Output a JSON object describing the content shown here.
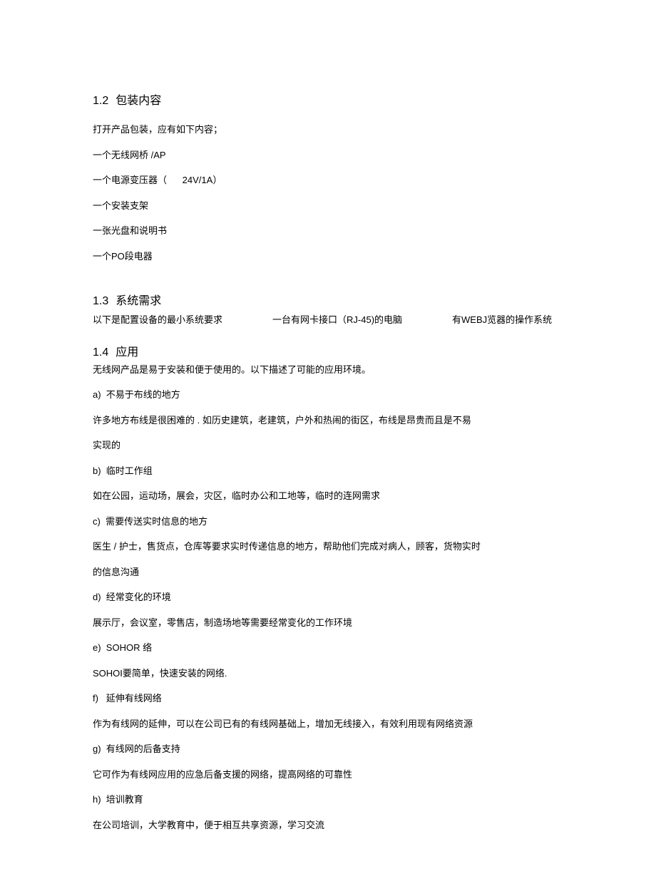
{
  "section_1_2": {
    "number": "1.2",
    "title": "包装内容",
    "intro": "打开产品包装，应有如下内容；",
    "items": [
      "一个无线网桥 /AP",
      "一个电源变压器（      24V/1A）",
      "一个安装支架",
      "一张光盘和说明书",
      "一个PO段电器"
    ]
  },
  "section_1_3": {
    "number": "1.3",
    "title": "系统需求",
    "line_a": "以下是配置设备的最小系统要求",
    "line_b": "一台有网卡接口（RJ-45)的电脑",
    "line_c": "有WEBJ览器的操作系统"
  },
  "section_1_4": {
    "number": "1.4",
    "title": "应用",
    "intro": "无线网产品是易于安装和便于使用的。以下描述了可能的应用环境。",
    "items": [
      {
        "label": "a)",
        "title": "不易于布线的地方",
        "body": [
          "许多地方布线是很困难的 . 如历史建筑，老建筑，户外和热闹的街区，布线是昂贵而且是不易",
          "实现的"
        ]
      },
      {
        "label": "b)",
        "title": "临时工作组",
        "body": [
          "如在公园，运动场，展会，灾区，临时办公和工地等，临时的连网需求"
        ]
      },
      {
        "label": "c)",
        "title": "需要传送实时信息的地方",
        "body": [
          "医生 / 护士，售货点，仓库等要求实时传递信息的地方，帮助他们完成对病人，顾客，货物实时",
          "的信息沟通"
        ]
      },
      {
        "label": "d)",
        "title": "经常变化的环境",
        "body": [
          "展示厅，会议室，零售店，制造场地等需要经常变化的工作环境"
        ]
      },
      {
        "label": "e)",
        "title": "SOHOI网 络",
        "title_render": "SOHOR 络",
        "body": [
          "SOHOI要简单，快速安装的网络."
        ]
      },
      {
        "label": "f)",
        "title": "延伸有线网络",
        "body": [
          "作为有线网的延伸，可以在公司已有的有线网基础上，增加无线接入，有效利用现有网络资源"
        ]
      },
      {
        "label": "g)",
        "title": "有线网的后备支持",
        "body": [
          "它可作为有线网应用的应急后备支援的网络，提高网络的可靠性"
        ]
      },
      {
        "label": "h)",
        "title": "培训教育",
        "body": [
          "在公司培训，大学教育中，便于相互共享资源，学习交流"
        ]
      }
    ]
  }
}
